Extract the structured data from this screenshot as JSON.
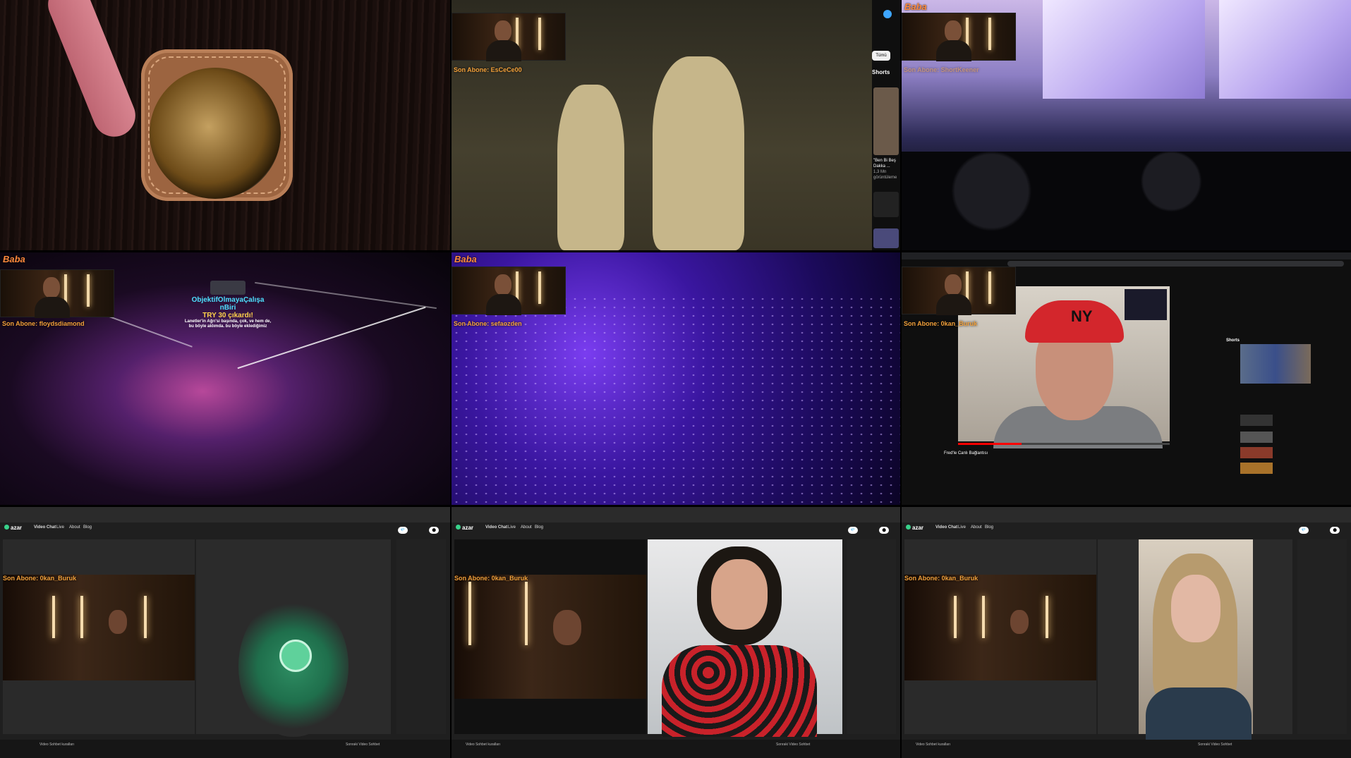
{
  "brand": "Baba",
  "cells": {
    "c2": {
      "subscriber": "Son Abone: EsCeCe00",
      "chip": "Tümü",
      "shorts_label": "Shorts",
      "short_caption": "\"Ben Bi Beş Dakka ...",
      "short_views": "1,3 Mn görüntüleme"
    },
    "c3": {
      "subscriber": "Son Abone: ShortKeener"
    },
    "c4": {
      "subscriber": "Son Abone: floydsdiamond",
      "donor": "ObjektifOlmayaÇalışa",
      "donor2": "nBiri",
      "amount": "TRY 30 çıkardı!",
      "message": "Lanetler'in Ağrı'si başında, çok, ve hem de, bu böyle aklımda. bu böyle eklediğimiz"
    },
    "c5": {
      "subscriber": "Son Abone: sefaozden"
    },
    "c6": {
      "subscriber": "Son Abone: 0kan_Buruk",
      "video_title": "Fred'le Canlı Bağlantısı",
      "shorts_label": "Shorts"
    },
    "c7": {
      "subscriber": "Son Abone: 0kan_Buruk",
      "nav": [
        "Video Chat",
        "Live",
        "About",
        "Blog"
      ],
      "footer_left": "Video Sohbet kuralları",
      "footer_right": "Sonraki Video Sohbet"
    },
    "c8": {
      "subscriber": "Son Abone: 0kan_Buruk",
      "nav": [
        "Video Chat",
        "Live",
        "About",
        "Blog"
      ],
      "footer_left": "Video Sohbet kuralları",
      "footer_right": "Sonraki Video Sohbet"
    },
    "c9": {
      "subscriber": "Son Abone: 0kan_Buruk",
      "nav": [
        "Video Chat",
        "Live",
        "About",
        "Blog"
      ],
      "footer_left": "Video Sohbet kuralları",
      "footer_right": "Sonraki Video Sohbet"
    }
  },
  "azar_logo": "azar",
  "colors": {
    "subscriber_text": "#f2a03a",
    "azar_green": "#38d18a"
  }
}
